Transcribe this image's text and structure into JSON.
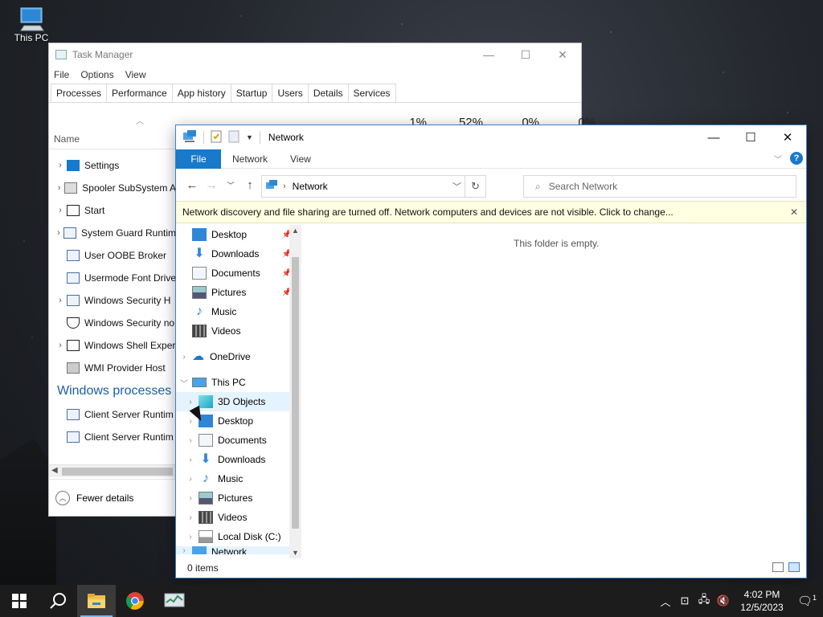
{
  "desktop": {
    "icons": [
      {
        "label": "This PC",
        "icon": "this-pc-icon"
      }
    ]
  },
  "task_manager": {
    "title": "Task Manager",
    "menu": [
      "File",
      "Options",
      "View"
    ],
    "tabs": [
      "Processes",
      "Performance",
      "App history",
      "Startup",
      "Users",
      "Details",
      "Services"
    ],
    "active_tab": "Processes",
    "column_name": "Name",
    "percents": [
      "1%",
      "52%",
      "0%",
      "0%"
    ],
    "rows": [
      {
        "label": "Settings",
        "expandable": true
      },
      {
        "label": "Spooler SubSystem A",
        "expandable": true
      },
      {
        "label": "Start",
        "expandable": true
      },
      {
        "label": "System Guard Runtim",
        "expandable": true
      },
      {
        "label": "User OOBE Broker",
        "expandable": false
      },
      {
        "label": "Usermode Font Drive",
        "expandable": false
      },
      {
        "label": "Windows Security H",
        "expandable": true
      },
      {
        "label": "Windows Security no",
        "expandable": false
      },
      {
        "label": "Windows Shell Exper",
        "expandable": true
      },
      {
        "label": "WMI Provider Host",
        "expandable": false
      }
    ],
    "group": "Windows processes (",
    "group_rows": [
      {
        "label": "Client Server Runtim",
        "expandable": false
      },
      {
        "label": "Client Server Runtim",
        "expandable": false
      }
    ],
    "fewer_details": "Fewer details"
  },
  "explorer": {
    "title": "Network",
    "ribbon_tabs": [
      "File",
      "Network",
      "View"
    ],
    "address": "Network",
    "search_placeholder": "Search Network",
    "info_bar": "Network discovery and file sharing are turned off. Network computers and devices are not visible. Click to change...",
    "quick_access": [
      {
        "label": "Desktop",
        "icon": "desktop-icon",
        "pinned": true
      },
      {
        "label": "Downloads",
        "icon": "downloads-icon",
        "pinned": true
      },
      {
        "label": "Documents",
        "icon": "documents-icon",
        "pinned": true
      },
      {
        "label": "Pictures",
        "icon": "pictures-icon",
        "pinned": true
      },
      {
        "label": "Music",
        "icon": "music-icon",
        "pinned": false
      },
      {
        "label": "Videos",
        "icon": "videos-icon",
        "pinned": false
      }
    ],
    "onedrive": "OneDrive",
    "this_pc": "This PC",
    "this_pc_items": [
      {
        "label": "3D Objects",
        "icon": "3d-objects-icon"
      },
      {
        "label": "Desktop",
        "icon": "desktop-icon"
      },
      {
        "label": "Documents",
        "icon": "documents-icon"
      },
      {
        "label": "Downloads",
        "icon": "downloads-icon"
      },
      {
        "label": "Music",
        "icon": "music-icon"
      },
      {
        "label": "Pictures",
        "icon": "pictures-icon"
      },
      {
        "label": "Videos",
        "icon": "videos-icon"
      },
      {
        "label": "Local Disk (C:)",
        "icon": "local-disk-icon"
      }
    ],
    "network_partial": "Network",
    "empty_message": "This folder is empty.",
    "status": "0 items"
  },
  "taskbar": {
    "time": "4:02 PM",
    "date": "12/5/2023",
    "notification_count": "1"
  }
}
